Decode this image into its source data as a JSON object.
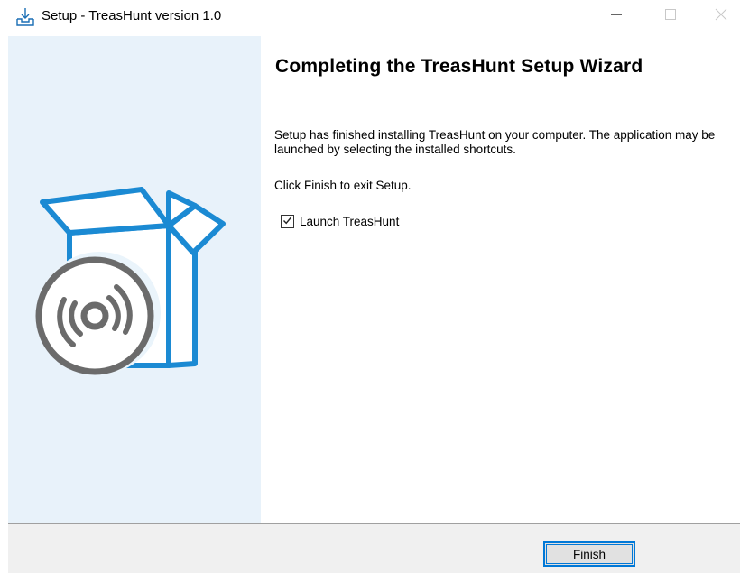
{
  "window": {
    "title": "Setup - TreasHunt version 1.0",
    "icon": "installer-download-icon",
    "controls": {
      "minimize_icon": "minimize-icon",
      "maximize_icon": "maximize-icon",
      "close_icon": "close-icon"
    }
  },
  "banner": {
    "image": "box-with-disc-illustration",
    "colors": {
      "background": "#e8f2fa",
      "box": "#1b8ad3",
      "disc": "#6b6b6b"
    }
  },
  "main": {
    "heading": "Completing the TreasHunt Setup Wizard",
    "paragraph1": "Setup has finished installing TreasHunt on your computer. The application may be launched by selecting the installed shortcuts.",
    "paragraph2": "Click Finish to exit Setup.",
    "launch_checkbox": {
      "label": "Launch TreasHunt",
      "checked": true
    }
  },
  "footer": {
    "finish_label": "Finish",
    "accent": "#0078d7"
  }
}
